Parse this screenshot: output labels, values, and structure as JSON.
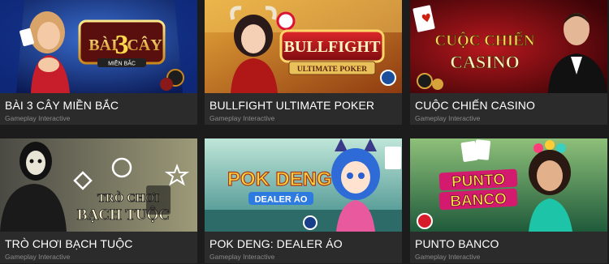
{
  "games": [
    {
      "title": "BÀI 3 CÂY MIỀN BẮC",
      "provider": "Gameplay Interactive",
      "logo_line1": "BÀI",
      "logo_num": "3",
      "logo_line2": "CÂY",
      "logo_sub": "MIỀN BẮC",
      "thumb_icon": "card-dealer-girl-art"
    },
    {
      "title": "BULLFIGHT ULTIMATE POKER",
      "provider": "Gameplay Interactive",
      "logo_line1": "BULLFIGHT",
      "logo_line2": "ULTIMATE POKER",
      "thumb_icon": "bull-girl-art"
    },
    {
      "title": "CUỘC CHIẾN CASINO",
      "provider": "Gameplay Interactive",
      "logo_line1": "CUỘC CHIẾN",
      "logo_line2": "CASINO",
      "thumb_icon": "croupier-man-art"
    },
    {
      "title": "TRÒ CHƠI BẠCH TUỘC",
      "provider": "Gameplay Interactive",
      "logo_line1": "TRÒ CHƠI",
      "logo_line2": "BẠCH TUỘC",
      "thumb_icon": "masked-guard-art"
    },
    {
      "title": "POK DENG: DEALER ÁO",
      "provider": "Gameplay Interactive",
      "logo_line1": "POK",
      "logo_line1b": "DENG",
      "logo_line2": "DEALER ÁO",
      "thumb_icon": "anime-girl-art"
    },
    {
      "title": "PUNTO BANCO",
      "provider": "Gameplay Interactive",
      "logo_line1": "PUNTO",
      "logo_line2": "BANCO",
      "thumb_icon": "flower-girl-art"
    }
  ],
  "colors": {
    "page_bg": "#1c1c1c",
    "card_info_bg": "#2b2b2b",
    "title": "#ffffff",
    "provider": "#8a8a8a"
  }
}
